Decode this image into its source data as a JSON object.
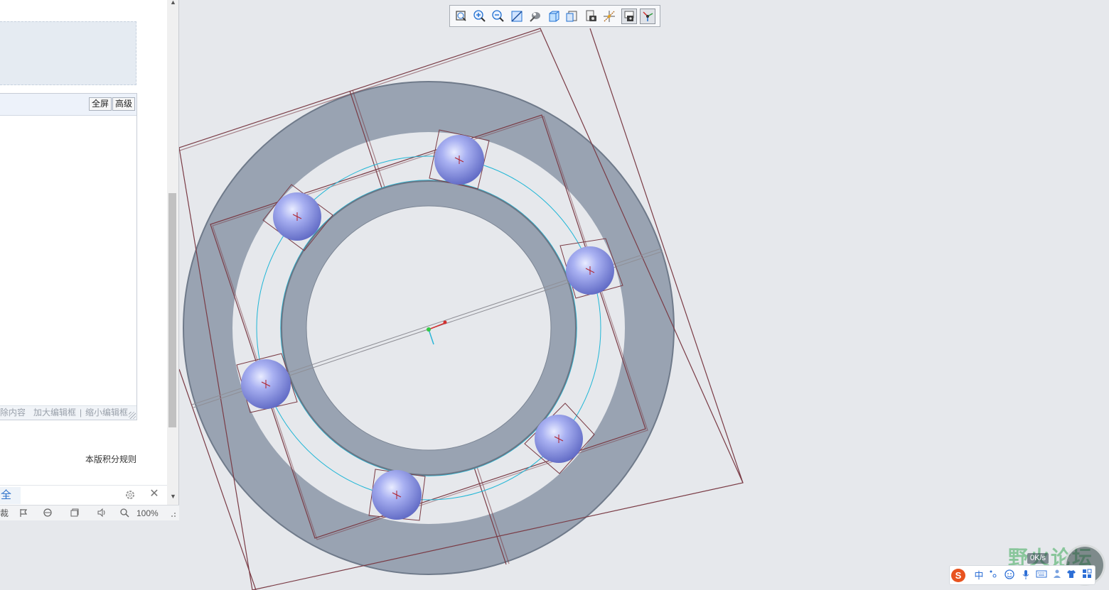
{
  "editor": {
    "fullscreen_label": "全屏",
    "advanced_label": "高级",
    "footer": {
      "delete_label": "除内容",
      "enlarge_label": "加大编辑框",
      "separator": "|",
      "shrink_label": "缩小编辑框"
    }
  },
  "forum": {
    "rules_link": "本版积分规则"
  },
  "browser": {
    "search_tab": "全",
    "statusbar": {
      "cut_label": "裁",
      "zoom_level": "100%"
    }
  },
  "view_toolbar": {
    "tools": [
      {
        "icon": "zoom-window-icon"
      },
      {
        "icon": "zoom-in-icon"
      },
      {
        "icon": "zoom-out-icon"
      },
      {
        "icon": "refit-icon"
      },
      {
        "icon": "shading-icon"
      },
      {
        "icon": "saved-views-icon"
      },
      {
        "icon": "named-views-icon"
      },
      {
        "icon": "view-manager-icon"
      },
      {
        "icon": "datum-display-icon"
      },
      {
        "icon": "annotation-display-icon",
        "active": true
      },
      {
        "icon": "spin-center-icon",
        "active": true
      }
    ]
  },
  "model": {
    "description_colors": {
      "ring": "#99a3b2",
      "ring_dark": "#6f7a8a",
      "ball": "#9ea8ee",
      "datum_line": "#7a3b45",
      "axis_circle": "#1fb6d6",
      "background": "#e6e8ec"
    },
    "ball_count": 6
  },
  "ime": {
    "logo": "S",
    "mode_label": "中",
    "watermark_text": "野火论坛",
    "net_speed": "0K/s"
  }
}
